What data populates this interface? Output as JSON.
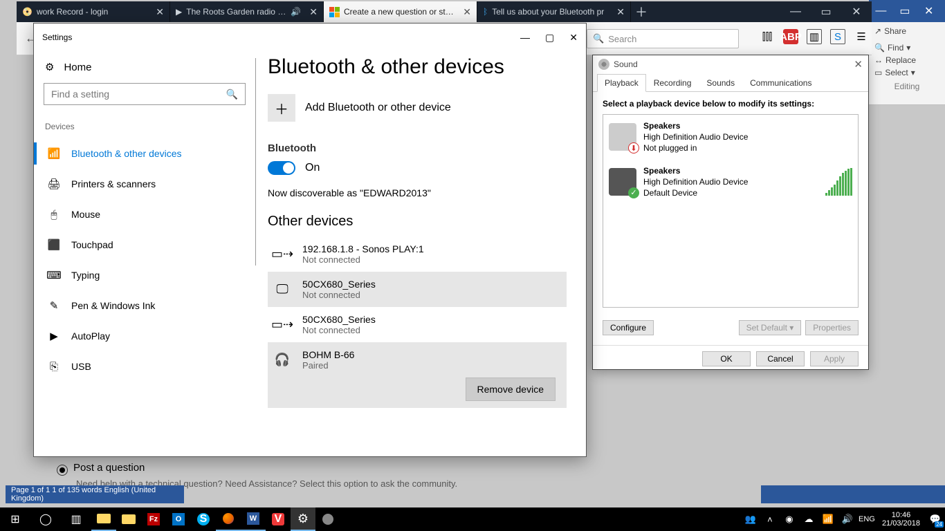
{
  "browser": {
    "tabs": [
      {
        "label": "work Record - login",
        "active": false,
        "icon": "record"
      },
      {
        "label": "The Roots Garden radio sho",
        "active": false,
        "icon": "play",
        "audio": true
      },
      {
        "label": "Create a new question or start a",
        "active": true,
        "icon": "winlogo"
      },
      {
        "label": "Tell us about your Bluetooth pr",
        "active": false,
        "icon": "bluetooth"
      }
    ],
    "search_placeholder": "Search",
    "toolbar_icons": [
      "library",
      "abp",
      "reader",
      "screenshot",
      "menu"
    ]
  },
  "word_ribbon": {
    "share": "Share",
    "find": "Find",
    "replace": "Replace",
    "select": "Select",
    "group": "Editing"
  },
  "word_status_left": "Page 1 of 1    1 of 135 words    English (United Kingdom)",
  "settings": {
    "window_title": "Settings",
    "home": "Home",
    "search_placeholder": "Find a setting",
    "section": "Devices",
    "nav": [
      {
        "icon": "📶",
        "label": "Bluetooth & other devices",
        "active": true
      },
      {
        "icon": "🖨",
        "label": "Printers & scanners"
      },
      {
        "icon": "🖱",
        "label": "Mouse"
      },
      {
        "icon": "⬛",
        "label": "Touchpad"
      },
      {
        "icon": "⌨",
        "label": "Typing"
      },
      {
        "icon": "✎",
        "label": "Pen & Windows Ink"
      },
      {
        "icon": "▶",
        "label": "AutoPlay"
      },
      {
        "icon": "⎘",
        "label": "USB"
      }
    ],
    "page_title": "Bluetooth & other devices",
    "add_label": "Add Bluetooth or other device",
    "bluetooth_heading": "Bluetooth",
    "toggle_state": "On",
    "discoverable": "Now discoverable as \"EDWARD2013\"",
    "other_heading": "Other devices",
    "devices": [
      {
        "name": "192.168.1.8 - Sonos PLAY:1",
        "status": "Not connected",
        "icon": "cast",
        "selected": false
      },
      {
        "name": "50CX680_Series",
        "status": "Not connected",
        "icon": "tv",
        "selected": true
      },
      {
        "name": "50CX680_Series",
        "status": "Not connected",
        "icon": "cast",
        "selected": false
      },
      {
        "name": "BOHM B-66",
        "status": "Paired",
        "icon": "headset",
        "selected": true
      }
    ],
    "remove_label": "Remove device"
  },
  "post_question": {
    "title": "Post a question",
    "sub": "Need help with a technical question? Need Assistance? Select this option to ask the community."
  },
  "sound": {
    "title": "Sound",
    "tabs": [
      "Playback",
      "Recording",
      "Sounds",
      "Communications"
    ],
    "active_tab": 0,
    "hint": "Select a playback device below to modify its settings:",
    "items": [
      {
        "name": "Speakers",
        "desc": "High Definition Audio Device",
        "status": "Not plugged in",
        "badge": "red"
      },
      {
        "name": "Speakers",
        "desc": "High Definition Audio Device",
        "status": "Default Device",
        "badge": "green",
        "level": true
      }
    ],
    "configure": "Configure",
    "set_default": "Set Default",
    "properties": "Properties",
    "ok": "OK",
    "cancel": "Cancel",
    "apply": "Apply"
  },
  "taskbar": {
    "lang": "ENG",
    "time": "10:46",
    "date": "21/03/2018",
    "notif_count": "24"
  }
}
